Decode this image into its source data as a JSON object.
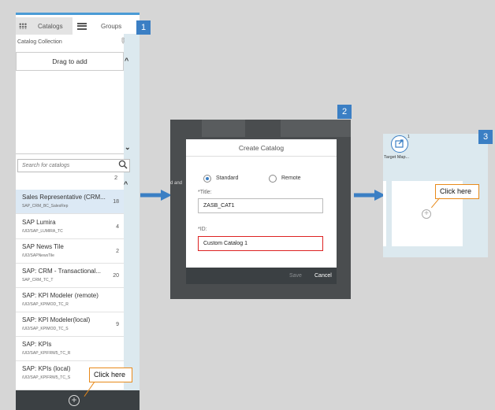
{
  "panel1": {
    "tabs": [
      {
        "label": "Catalogs",
        "icon": "grid-icon"
      },
      {
        "label": "Groups",
        "icon": "list-icon"
      }
    ],
    "collection_title": "Catalog Collection",
    "drag_to_add": "Drag to add",
    "search_placeholder": "Search for catalogs",
    "top_count": "2",
    "items": [
      {
        "title": "Sales Representative (CRM...",
        "sub": "SAP_CRM_BC_SalesRep",
        "count": "18"
      },
      {
        "title": "SAP Lumira",
        "sub": "/UI2/SAP_LUMIRA_TC",
        "count": "4"
      },
      {
        "title": "SAP News Tile",
        "sub": "/UI2/SAPNewsTile",
        "count": "2"
      },
      {
        "title": "SAP: CRM - Transactional...",
        "sub": "SAP_CRM_TC_T",
        "count": "20"
      },
      {
        "title": "SAP: KPI Modeler (remote)",
        "sub": "/UI2/SAP_KPIMOD_TC_R",
        "count": ""
      },
      {
        "title": "SAP: KPI Modeler(local)",
        "sub": "/UI2/SAP_KPIMOD_TC_S",
        "count": "9"
      },
      {
        "title": "SAP: KPIs",
        "sub": "/UI2/SAP_KPIFRW5_TC_R",
        "count": ""
      },
      {
        "title": "SAP: KPIs (local)",
        "sub": "/UI2/SAP_KPIFRW5_TC_S",
        "count": ""
      }
    ],
    "callout": "Click here",
    "badge": "1"
  },
  "panel2": {
    "badge": "2",
    "dialog_title": "Create Catalog",
    "radio_standard": "Standard",
    "radio_remote": "Remote",
    "title_label": "*Title:",
    "title_value": "ZASB_CAT1",
    "id_label": "*ID:",
    "id_value": "Custom Catalog 1",
    "save_label": "Save",
    "cancel_label": "Cancel",
    "side_text": "d and"
  },
  "panel3": {
    "badge": "3",
    "target_label": "Target Map...",
    "target_sup": "1",
    "callout": "Click here"
  },
  "colors": {
    "accent": "#3b7fc4",
    "callout_border": "#e88a1a",
    "error_border": "#dd2222",
    "footer_bar": "#3b4043"
  }
}
